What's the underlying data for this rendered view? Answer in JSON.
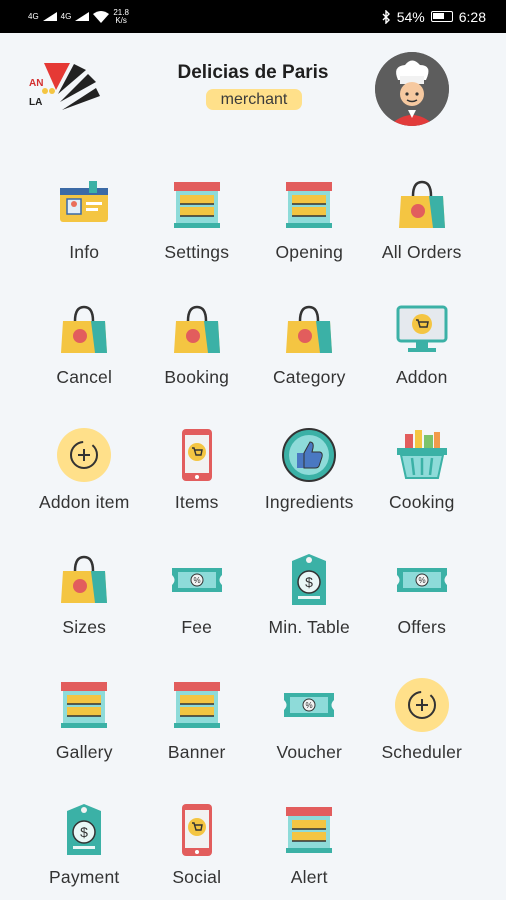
{
  "status_bar": {
    "signal1": "4G",
    "signal2": "4G",
    "net_speed": "21.8",
    "net_unit": "K/s",
    "battery": "54%",
    "time": "6:28",
    "icons": [
      "signal-icon",
      "wifi-icon",
      "bluetooth-icon",
      "battery-icon"
    ]
  },
  "header": {
    "logo_text_1": "AN",
    "logo_text_2": "LA",
    "title": "Delicias de Paris",
    "role_badge": "merchant",
    "badge_color": "#ffe08a"
  },
  "menu": [
    {
      "label": "Info",
      "icon": "id-card-icon"
    },
    {
      "label": "Settings",
      "icon": "store-icon"
    },
    {
      "label": "Opening",
      "icon": "store-icon"
    },
    {
      "label": "All Orders",
      "icon": "shopping-bag-icon"
    },
    {
      "label": "Cancel",
      "icon": "shopping-bag-icon"
    },
    {
      "label": "Booking",
      "icon": "shopping-bag-icon"
    },
    {
      "label": "Category",
      "icon": "shopping-bag-icon"
    },
    {
      "label": "Addon",
      "icon": "monitor-cart-icon"
    },
    {
      "label": "Addon item",
      "icon": "add-circle-icon"
    },
    {
      "label": "Items",
      "icon": "phone-cart-icon"
    },
    {
      "label": "Ingredients",
      "icon": "thumbs-up-icon"
    },
    {
      "label": "Cooking",
      "icon": "basket-icon"
    },
    {
      "label": "Sizes",
      "icon": "shopping-bag-icon"
    },
    {
      "label": "Fee",
      "icon": "coupon-icon"
    },
    {
      "label": "Min. Table",
      "icon": "money-tag-icon"
    },
    {
      "label": "Offers",
      "icon": "coupon-icon"
    },
    {
      "label": "Gallery",
      "icon": "store-icon"
    },
    {
      "label": "Banner",
      "icon": "store-icon"
    },
    {
      "label": "Voucher",
      "icon": "coupon-icon"
    },
    {
      "label": "Scheduler",
      "icon": "add-circle-icon"
    },
    {
      "label": "Payment",
      "icon": "money-tag-icon"
    },
    {
      "label": "Social",
      "icon": "phone-cart-icon"
    },
    {
      "label": "Alert",
      "icon": "store-icon"
    }
  ]
}
